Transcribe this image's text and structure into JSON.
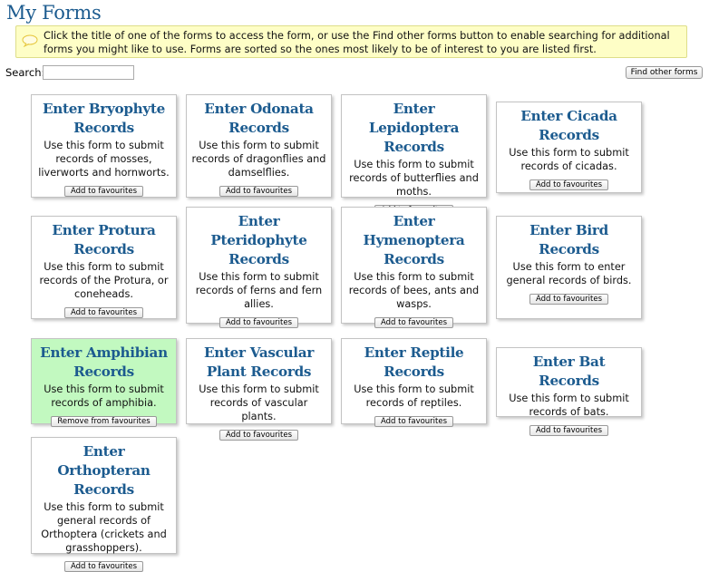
{
  "page": {
    "title": "My Forms",
    "hint": "Click the title of one of the forms to access the form, or use the Find other forms button to enable searching for additional forms you might like to use. Forms are sorted so the ones most likely to be of interest to you are listed first."
  },
  "search": {
    "label": "Search:",
    "value": "",
    "placeholder": ""
  },
  "find_button": "Find other forms",
  "forms": [
    {
      "title": "Enter Bryophyte Records",
      "description": "Use this form to submit records of mosses, liverworts and hornworts.",
      "button": "Add to favourites",
      "favourite": false
    },
    {
      "title": "Enter Odonata Records",
      "description": "Use this form to submit records of dragonflies and damselflies.",
      "button": "Add to favourites",
      "favourite": false
    },
    {
      "title": "Enter Lepidoptera Records",
      "description": "Use this form to submit records of butterflies and moths.",
      "button": "Add to favourites",
      "favourite": false
    },
    {
      "title": "Enter Cicada Records",
      "description": "Use this form to submit records of cicadas.",
      "button": "Add to favourites",
      "favourite": false
    },
    {
      "title": "Enter Protura Records",
      "description": "Use this form to submit records of the Protura, or coneheads.",
      "button": "Add to favourites",
      "favourite": false
    },
    {
      "title": "Enter Pteridophyte Records",
      "description": "Use this form to submit records of ferns and fern allies.",
      "button": "Add to favourites",
      "favourite": false
    },
    {
      "title": "Enter Hymenoptera Records",
      "description": "Use this form to submit records of bees, ants and wasps.",
      "button": "Add to favourites",
      "favourite": false
    },
    {
      "title": "Enter Bird Records",
      "description": "Use this form to enter general records of birds.",
      "button": "Add to favourites",
      "favourite": false
    },
    {
      "title": "Enter Amphibian Records",
      "description": "Use this form to submit records of amphibia.",
      "button": "Remove from favourites",
      "favourite": true
    },
    {
      "title": "Enter Vascular Plant Records",
      "description": "Use this form to submit records of vascular plants.",
      "button": "Add to favourites",
      "favourite": false
    },
    {
      "title": "Enter Reptile Records",
      "description": "Use this form to submit records of reptiles.",
      "button": "Add to favourites",
      "favourite": false
    },
    {
      "title": "Enter Bat Records",
      "description": "Use this form to submit records of bats.",
      "button": "Add to favourites",
      "favourite": false
    },
    {
      "title": "Enter Orthopteran Records",
      "description": "Use this form to submit general records of Orthoptera (crickets and grasshoppers).",
      "button": "Add to favourites",
      "favourite": false
    }
  ]
}
